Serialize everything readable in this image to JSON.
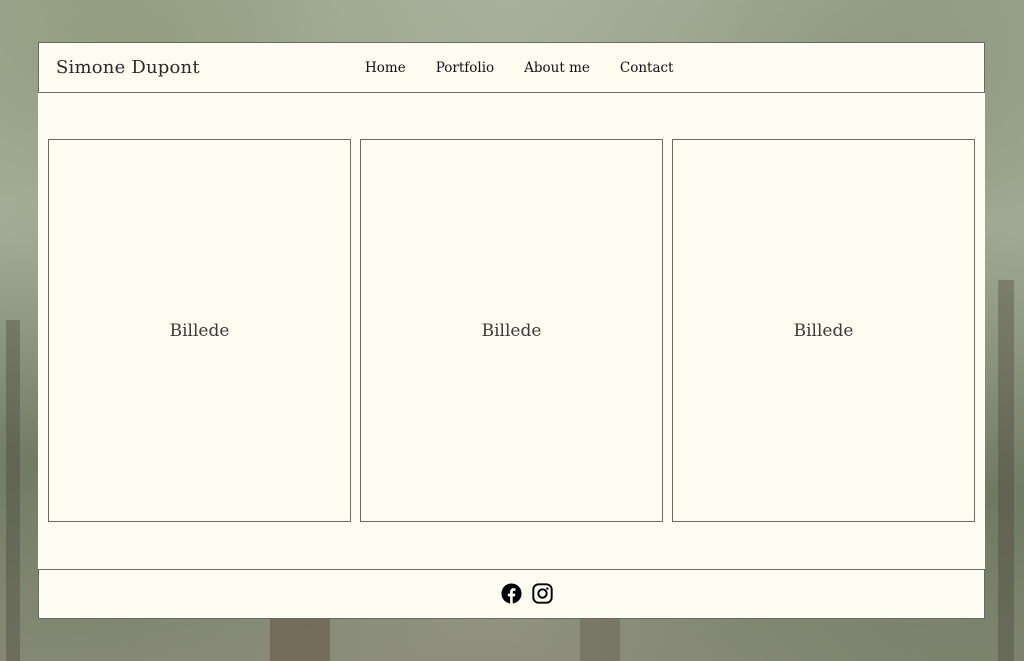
{
  "header": {
    "site_title": "Simone Dupont",
    "nav": [
      "Home",
      "Portfolio",
      "About me",
      "Contact"
    ]
  },
  "gallery": {
    "items": [
      {
        "label": "Billede"
      },
      {
        "label": "Billede"
      },
      {
        "label": "Billede"
      }
    ]
  },
  "footer": {
    "social_icons": [
      "facebook-icon",
      "instagram-icon"
    ]
  },
  "colors": {
    "card_background": "#fdfcf0",
    "border": "#6a6a64",
    "text": "#111111"
  }
}
